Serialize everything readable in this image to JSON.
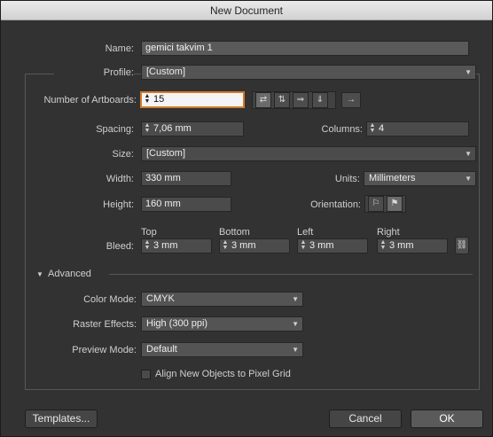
{
  "window": {
    "title": "New Document"
  },
  "name": {
    "label": "Name:",
    "value": "gemici takvim 1"
  },
  "profile": {
    "label": "Profile:",
    "value": "[Custom]"
  },
  "artboards": {
    "label": "Number of Artboards:",
    "value": "15",
    "arrow_icon": "→"
  },
  "spacing": {
    "label": "Spacing:",
    "value": "7,06 mm"
  },
  "columns": {
    "label": "Columns:",
    "value": "4"
  },
  "size": {
    "label": "Size:",
    "value": "[Custom]"
  },
  "width": {
    "label": "Width:",
    "value": "330 mm"
  },
  "units": {
    "label": "Units:",
    "value": "Millimeters"
  },
  "height": {
    "label": "Height:",
    "value": "160 mm"
  },
  "orientation": {
    "label": "Orientation:"
  },
  "bleed": {
    "label": "Bleed:",
    "top_label": "Top",
    "top_value": "3 mm",
    "bottom_label": "Bottom",
    "bottom_value": "3 mm",
    "left_label": "Left",
    "left_value": "3 mm",
    "right_label": "Right",
    "right_value": "3 mm"
  },
  "advanced": {
    "label": "Advanced",
    "color_mode": {
      "label": "Color Mode:",
      "value": "CMYK"
    },
    "raster_effects": {
      "label": "Raster Effects:",
      "value": "High (300 ppi)"
    },
    "preview_mode": {
      "label": "Preview Mode:",
      "value": "Default"
    },
    "align_pixel_grid": {
      "label": "Align New Objects to Pixel Grid",
      "checked": false
    }
  },
  "buttons": {
    "templates": "Templates...",
    "cancel": "Cancel",
    "ok": "OK"
  }
}
